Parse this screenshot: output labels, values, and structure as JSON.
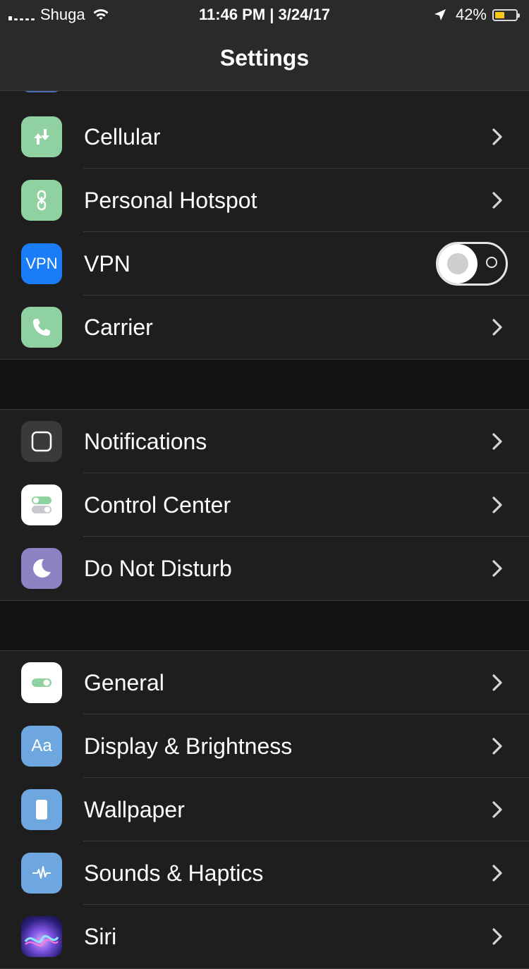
{
  "status_bar": {
    "carrier": "Shuga",
    "time_date": "11:46 PM | 3/24/17",
    "battery_percent": "42%",
    "battery_level": 0.42,
    "battery_color": "#f7c81a"
  },
  "nav": {
    "title": "Settings"
  },
  "groups": [
    {
      "items": [
        {
          "label": "Cellular",
          "icon": "cellular-icon",
          "color": "#8fd1a0",
          "control": "chevron"
        },
        {
          "label": "Personal Hotspot",
          "icon": "hotspot-icon",
          "color": "#8fd1a0",
          "control": "chevron"
        },
        {
          "label": "VPN",
          "icon": "vpn-icon",
          "icon_text": "VPN",
          "color": "#1a7cf7",
          "control": "toggle",
          "toggle_on": false
        },
        {
          "label": "Carrier",
          "icon": "phone-icon",
          "color": "#8fd1a0",
          "control": "chevron"
        }
      ]
    },
    {
      "items": [
        {
          "label": "Notifications",
          "icon": "notifications-icon",
          "color": "#3a3a3c",
          "control": "chevron"
        },
        {
          "label": "Control Center",
          "icon": "control-center-icon",
          "color": "#ffffff",
          "control": "chevron"
        },
        {
          "label": "Do Not Disturb",
          "icon": "moon-icon",
          "color": "#8d82c4",
          "control": "chevron"
        }
      ]
    },
    {
      "items": [
        {
          "label": "General",
          "icon": "general-icon",
          "color": "#ffffff",
          "control": "chevron"
        },
        {
          "label": "Display & Brightness",
          "icon": "display-icon",
          "icon_text": "Aa",
          "color": "#6ea7e0",
          "control": "chevron"
        },
        {
          "label": "Wallpaper",
          "icon": "wallpaper-icon",
          "color": "#6ea7e0",
          "control": "chevron"
        },
        {
          "label": "Sounds & Haptics",
          "icon": "sound-icon",
          "color": "#6ea7e0",
          "control": "chevron"
        },
        {
          "label": "Siri",
          "icon": "siri-icon",
          "color": "#4b3ba8",
          "control": "chevron"
        }
      ]
    }
  ]
}
